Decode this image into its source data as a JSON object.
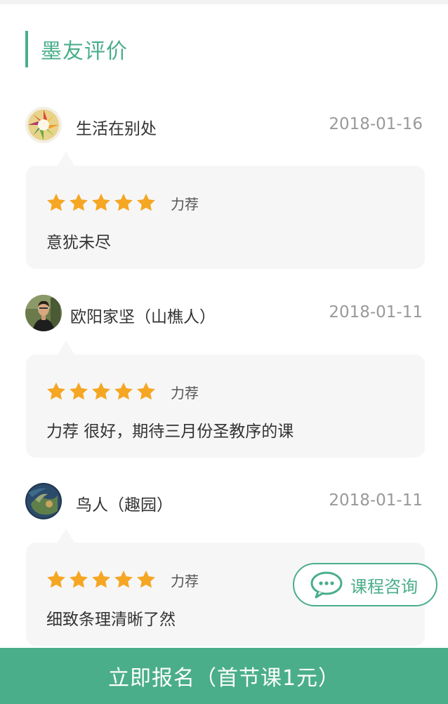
{
  "section": {
    "title": "墨友评价",
    "accent_color": "#4aae8a"
  },
  "star_color": "#f5a623",
  "reviews": [
    {
      "user": "生活在别处",
      "date": "2018-01-16",
      "stars": 5,
      "rating_label": "力荐",
      "text": "意犹未尽"
    },
    {
      "user": "欧阳家坚（山樵人）",
      "date": "2018-01-11",
      "stars": 5,
      "rating_label": "力荐",
      "text": "力荐 很好，期待三月份圣教序的课"
    },
    {
      "user": "鸟人（趣园）",
      "date": "2018-01-11",
      "stars": 5,
      "rating_label": "力荐",
      "text": "细致条理清晰了然"
    }
  ],
  "consult": {
    "label": "课程咨询",
    "icon": "chat-bubble-icon"
  },
  "signup": {
    "label": "立即报名（首节课1元）"
  }
}
